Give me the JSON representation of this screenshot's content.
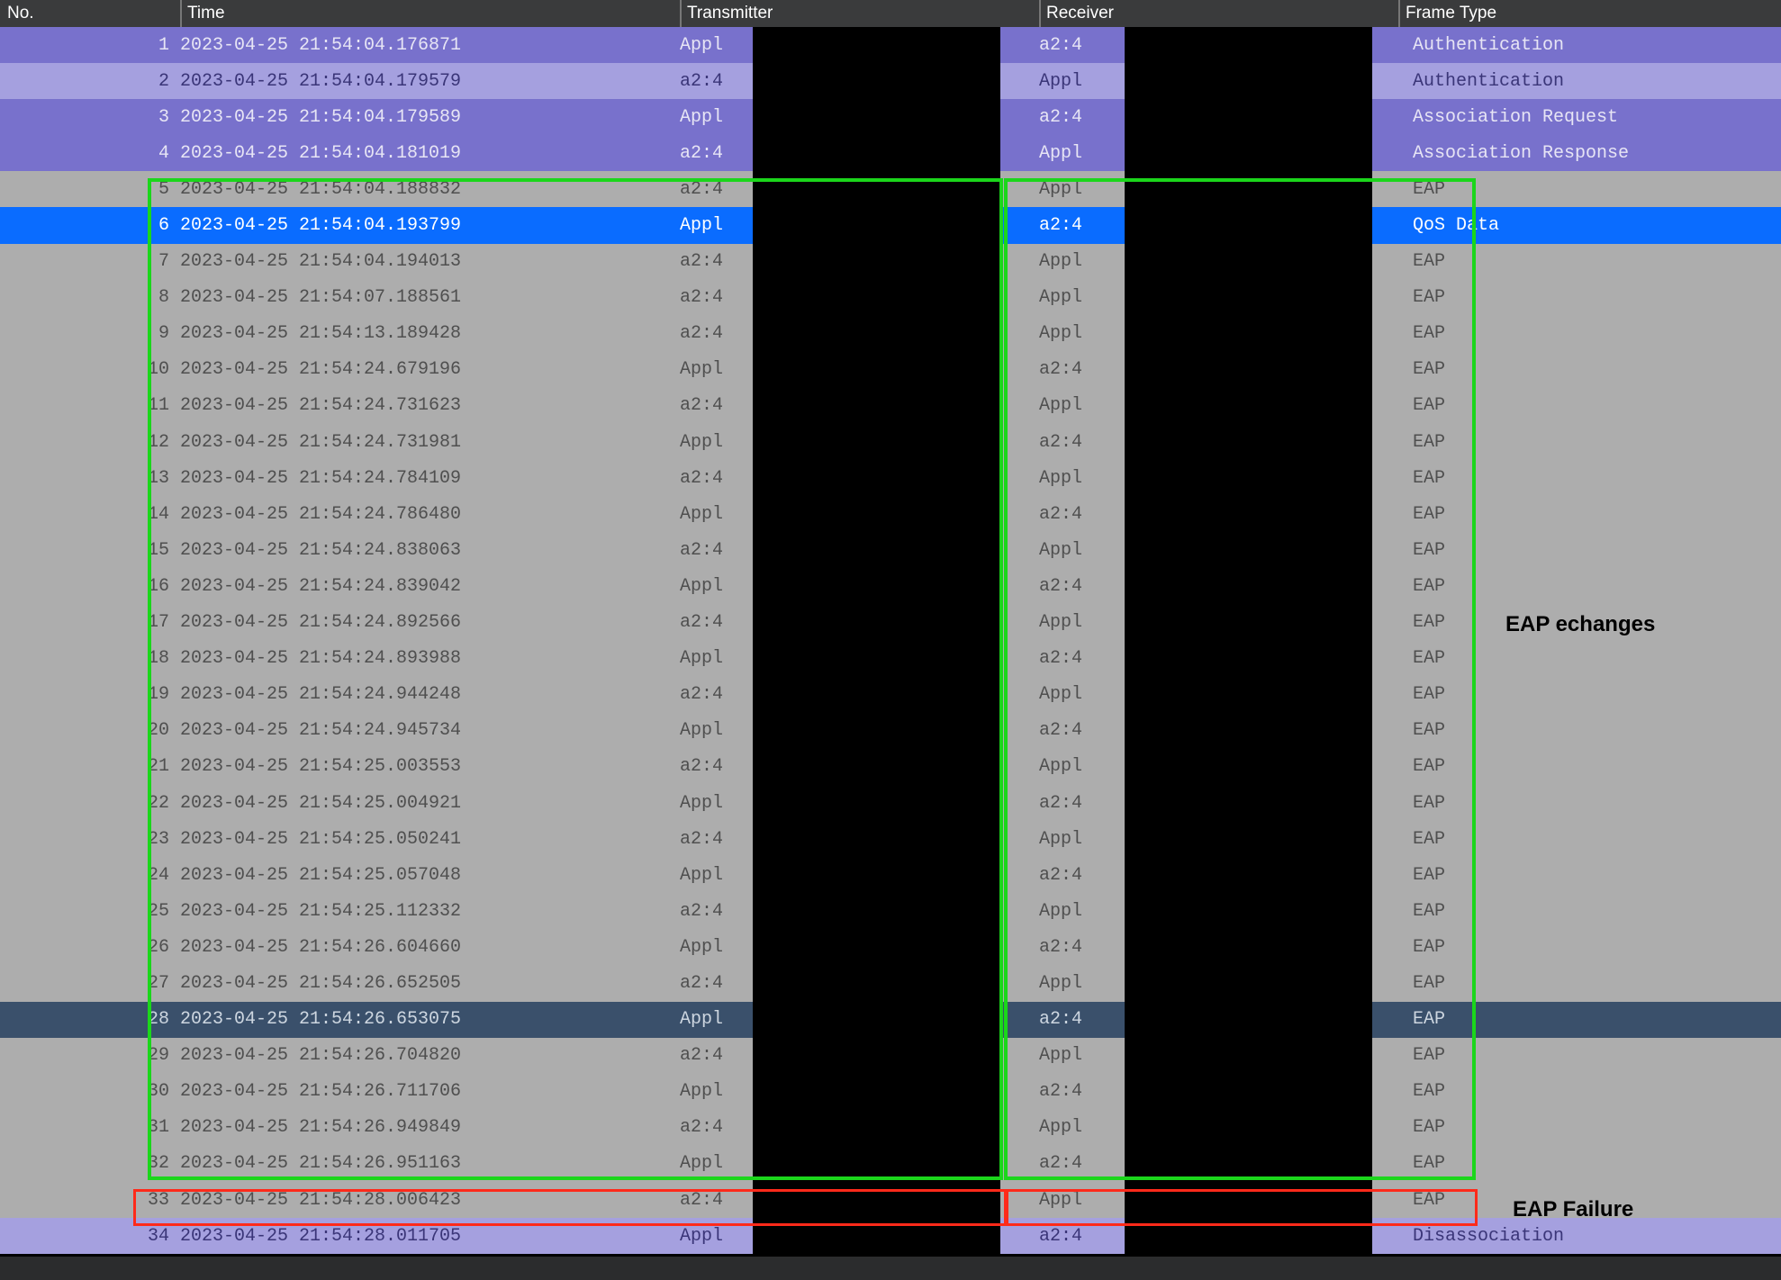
{
  "columns": {
    "no": "No.",
    "time": "Time",
    "transmitter": "Transmitter",
    "receiver": "Receiver",
    "frame_type": "Frame Type"
  },
  "annotations": {
    "eap_exchanges": "EAP echanges",
    "eap_failure": "EAP Failure"
  },
  "rows": [
    {
      "no": "1",
      "t": "2023-04-25 21:54:04.176871",
      "tx": "Appl",
      "rx": "a2:4",
      "ft": "Authentication",
      "cls": "purple-dark"
    },
    {
      "no": "2",
      "t": "2023-04-25 21:54:04.179579",
      "tx": "a2:4",
      "rx": "Appl",
      "ft": "Authentication",
      "cls": "purple-light"
    },
    {
      "no": "3",
      "t": "2023-04-25 21:54:04.179589",
      "tx": "Appl",
      "rx": "a2:4",
      "ft": "Association Request",
      "cls": "purple-dark"
    },
    {
      "no": "4",
      "t": "2023-04-25 21:54:04.181019",
      "tx": "a2:4",
      "rx": "Appl",
      "ft": "Association Response",
      "cls": "purple-dark"
    },
    {
      "no": "5",
      "t": "2023-04-25 21:54:04.188832",
      "tx": "a2:4",
      "rx": "Appl",
      "ft": "EAP",
      "cls": "gray"
    },
    {
      "no": "6",
      "t": "2023-04-25 21:54:04.193799",
      "tx": "Appl",
      "rx": "a2:4",
      "ft": "QoS Data",
      "cls": "blue-sel"
    },
    {
      "no": "7",
      "t": "2023-04-25 21:54:04.194013",
      "tx": "a2:4",
      "rx": "Appl",
      "ft": "EAP",
      "cls": "gray"
    },
    {
      "no": "8",
      "t": "2023-04-25 21:54:07.188561",
      "tx": "a2:4",
      "rx": "Appl",
      "ft": "EAP",
      "cls": "gray"
    },
    {
      "no": "9",
      "t": "2023-04-25 21:54:13.189428",
      "tx": "a2:4",
      "rx": "Appl",
      "ft": "EAP",
      "cls": "gray"
    },
    {
      "no": "10",
      "t": "2023-04-25 21:54:24.679196",
      "tx": "Appl",
      "rx": "a2:4",
      "ft": "EAP",
      "cls": "gray"
    },
    {
      "no": "11",
      "t": "2023-04-25 21:54:24.731623",
      "tx": "a2:4",
      "rx": "Appl",
      "ft": "EAP",
      "cls": "gray"
    },
    {
      "no": "12",
      "t": "2023-04-25 21:54:24.731981",
      "tx": "Appl",
      "rx": "a2:4",
      "ft": "EAP",
      "cls": "gray"
    },
    {
      "no": "13",
      "t": "2023-04-25 21:54:24.784109",
      "tx": "a2:4",
      "rx": "Appl",
      "ft": "EAP",
      "cls": "gray"
    },
    {
      "no": "14",
      "t": "2023-04-25 21:54:24.786480",
      "tx": "Appl",
      "rx": "a2:4",
      "ft": "EAP",
      "cls": "gray"
    },
    {
      "no": "15",
      "t": "2023-04-25 21:54:24.838063",
      "tx": "a2:4",
      "rx": "Appl",
      "ft": "EAP",
      "cls": "gray"
    },
    {
      "no": "16",
      "t": "2023-04-25 21:54:24.839042",
      "tx": "Appl",
      "rx": "a2:4",
      "ft": "EAP",
      "cls": "gray"
    },
    {
      "no": "17",
      "t": "2023-04-25 21:54:24.892566",
      "tx": "a2:4",
      "rx": "Appl",
      "ft": "EAP",
      "cls": "gray"
    },
    {
      "no": "18",
      "t": "2023-04-25 21:54:24.893988",
      "tx": "Appl",
      "rx": "a2:4",
      "ft": "EAP",
      "cls": "gray"
    },
    {
      "no": "19",
      "t": "2023-04-25 21:54:24.944248",
      "tx": "a2:4",
      "rx": "Appl",
      "ft": "EAP",
      "cls": "gray"
    },
    {
      "no": "20",
      "t": "2023-04-25 21:54:24.945734",
      "tx": "Appl",
      "rx": "a2:4",
      "ft": "EAP",
      "cls": "gray"
    },
    {
      "no": "21",
      "t": "2023-04-25 21:54:25.003553",
      "tx": "a2:4",
      "rx": "Appl",
      "ft": "EAP",
      "cls": "gray"
    },
    {
      "no": "22",
      "t": "2023-04-25 21:54:25.004921",
      "tx": "Appl",
      "rx": "a2:4",
      "ft": "EAP",
      "cls": "gray"
    },
    {
      "no": "23",
      "t": "2023-04-25 21:54:25.050241",
      "tx": "a2:4",
      "rx": "Appl",
      "ft": "EAP",
      "cls": "gray"
    },
    {
      "no": "24",
      "t": "2023-04-25 21:54:25.057048",
      "tx": "Appl",
      "rx": "a2:4",
      "ft": "EAP",
      "cls": "gray"
    },
    {
      "no": "25",
      "t": "2023-04-25 21:54:25.112332",
      "tx": "a2:4",
      "rx": "Appl",
      "ft": "EAP",
      "cls": "gray"
    },
    {
      "no": "26",
      "t": "2023-04-25 21:54:26.604660",
      "tx": "Appl",
      "rx": "a2:4",
      "ft": "EAP",
      "cls": "gray"
    },
    {
      "no": "27",
      "t": "2023-04-25 21:54:26.652505",
      "tx": "a2:4",
      "rx": "Appl",
      "ft": "EAP",
      "cls": "gray"
    },
    {
      "no": "28",
      "t": "2023-04-25 21:54:26.653075",
      "tx": "Appl",
      "rx": "a2:4",
      "ft": "EAP",
      "cls": "navy"
    },
    {
      "no": "29",
      "t": "2023-04-25 21:54:26.704820",
      "tx": "a2:4",
      "rx": "Appl",
      "ft": "EAP",
      "cls": "gray"
    },
    {
      "no": "30",
      "t": "2023-04-25 21:54:26.711706",
      "tx": "Appl",
      "rx": "a2:4",
      "ft": "EAP",
      "cls": "gray"
    },
    {
      "no": "31",
      "t": "2023-04-25 21:54:26.949849",
      "tx": "a2:4",
      "rx": "Appl",
      "ft": "EAP",
      "cls": "gray"
    },
    {
      "no": "32",
      "t": "2023-04-25 21:54:26.951163",
      "tx": "Appl",
      "rx": "a2:4",
      "ft": "EAP",
      "cls": "gray"
    },
    {
      "no": "33",
      "t": "2023-04-25 21:54:28.006423",
      "tx": "a2:4",
      "rx": "Appl",
      "ft": "EAP",
      "cls": "gray"
    },
    {
      "no": "34",
      "t": "2023-04-25 21:54:28.011705",
      "tx": "Appl",
      "rx": "a2:4",
      "ft": "Disassociation",
      "cls": "purple-light"
    }
  ]
}
